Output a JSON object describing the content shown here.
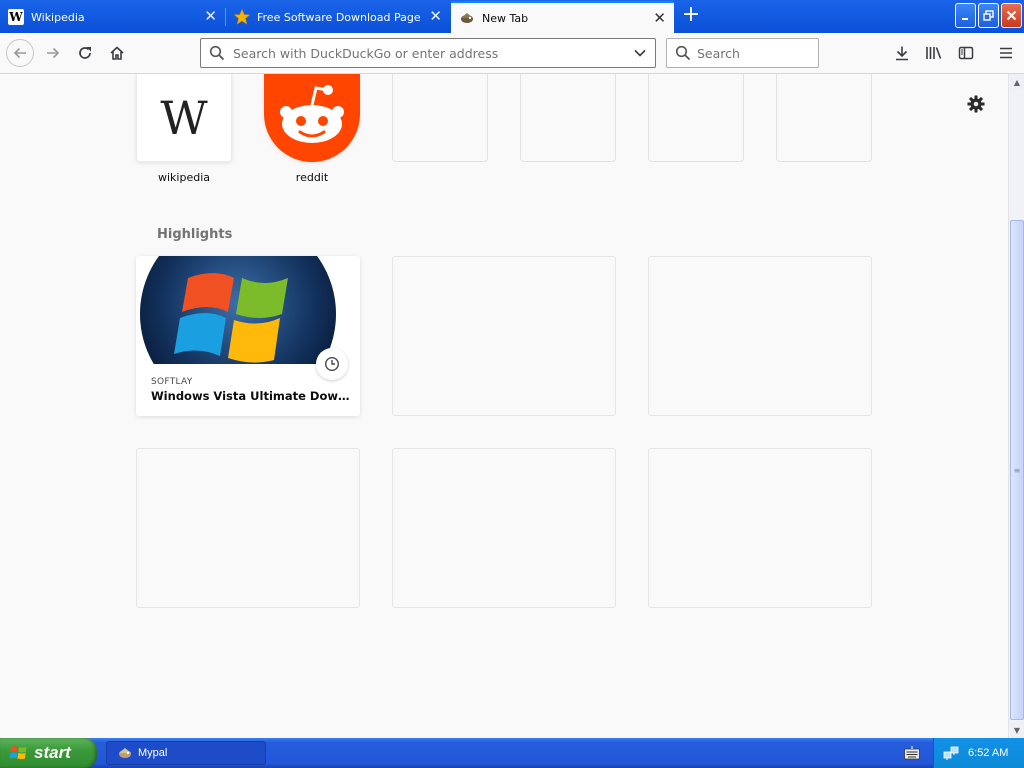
{
  "tabs": [
    {
      "title": "Wikipedia",
      "favicon": "wikipedia-icon",
      "active": false
    },
    {
      "title": "Free Software Download Page - So",
      "favicon": "star-icon",
      "active": false
    },
    {
      "title": "New Tab",
      "favicon": "mypal-icon",
      "active": true
    }
  ],
  "toolbar": {
    "url_placeholder": "Search with DuckDuckGo or enter address",
    "search_placeholder": "Search"
  },
  "top_sites": [
    {
      "label": "wikipedia",
      "icon": "wikipedia-logo"
    },
    {
      "label": "reddit",
      "icon": "reddit-logo"
    },
    {
      "label": ""
    },
    {
      "label": ""
    },
    {
      "label": ""
    },
    {
      "label": ""
    }
  ],
  "highlights": {
    "title": "Highlights",
    "cards": [
      {
        "host": "SOFTLAY",
        "title": "Windows Vista Ultimate Download Free",
        "image": "windows-logo",
        "badge": "clock-icon"
      }
    ]
  },
  "taskbar": {
    "start_label": "start",
    "task_label": "Mypal",
    "clock": "6:52 AM"
  },
  "colors": {
    "tab_bar": "#0a50d8",
    "accent": "#0a84ff",
    "reddit": "#ff4500",
    "start_green": "#3a9a3a"
  }
}
